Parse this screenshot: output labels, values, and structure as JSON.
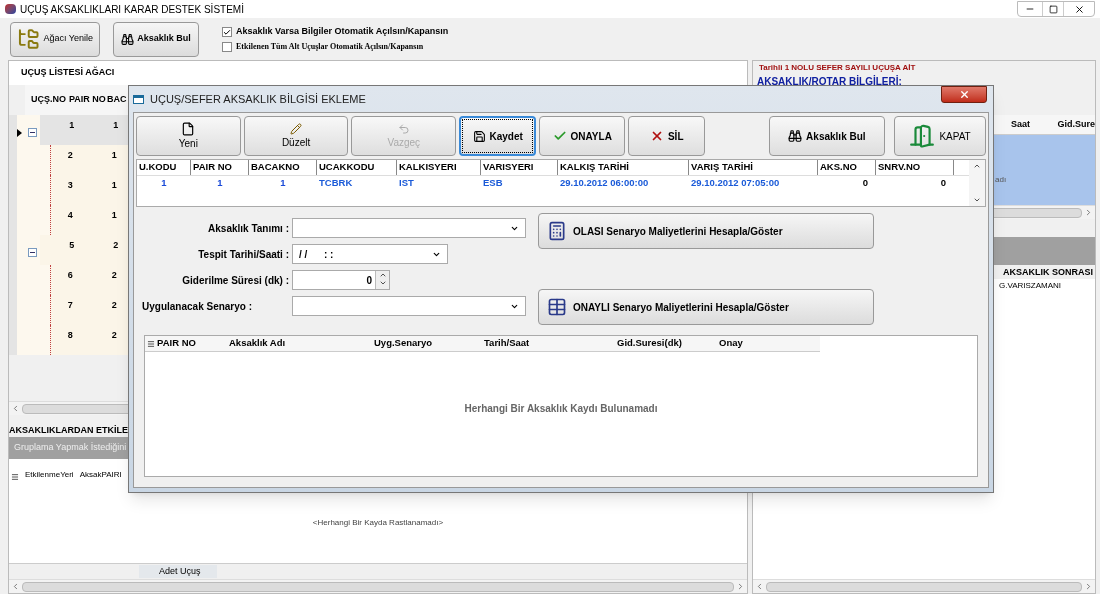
{
  "window": {
    "title": "UÇUŞ AKSAKLIKLARI KARAR DESTEK SİSTEMİ"
  },
  "toolbar": {
    "buttons": [
      {
        "label": "Ağacı Yenile",
        "kind": "tree"
      },
      {
        "label": "Aksaklık Bul",
        "kind": "find"
      }
    ],
    "options": [
      {
        "label": "Aksaklık Varsa Bilgiler Otomatik Açılsın/Kapansın",
        "checked": true
      },
      {
        "label": "Etkilenen Tüm Alt Uçuşlar Otomatik Açılsın/Kapansın",
        "checked": false
      }
    ]
  },
  "tree_panel": {
    "title": "UÇUŞ LİSTESİ AĞACI",
    "columns": [
      "UÇŞ.NO",
      "PAIR NO",
      "BAC"
    ],
    "rows": [
      {
        "uc_no": "1",
        "pair_no": "1",
        "selected": true,
        "expanded": true,
        "children": [
          {
            "uc_no": "2",
            "pair_no": "1",
            "selected": false
          },
          {
            "uc_no": "3",
            "pair_no": "1",
            "selected": false
          },
          {
            "uc_no": "4",
            "pair_no": "1",
            "selected": false
          }
        ]
      },
      {
        "uc_no": "5",
        "pair_no": "2",
        "selected": false,
        "expanded": true,
        "children": [
          {
            "uc_no": "6",
            "pair_no": "2",
            "selected": false
          },
          {
            "uc_no": "7",
            "pair_no": "2",
            "selected": false
          },
          {
            "uc_no": "8",
            "pair_no": "2",
            "selected": false
          }
        ]
      }
    ]
  },
  "affected_panel": {
    "title": "AKSAKLIKLARDAN ETKİLE",
    "group_hint": "Gruplama Yapmak İstediğini",
    "columns": [
      "EtkilenmeYeri",
      "AksakPAIRI"
    ],
    "empty": "<Herhangi Bir Kayda Rastlanamadı>",
    "footer": "Adet Uçuş"
  },
  "right_panel": {
    "title_line1": "Tarihli 1 NOLU SEFER SAYILI UÇUŞA AİT",
    "title_line2": "AKSAKLIK/ROTAR BİLGİLERİ:",
    "columns": [
      "Saat",
      "Gid.Sure"
    ],
    "row_fragment": "adı",
    "section": "AKSAKLIK SONRASI",
    "section_column": "G.VARISZAMANI"
  },
  "dialog": {
    "title": "UÇUŞ/SEFER AKSAKLIK BİLGİSİ EKLEME",
    "buttons": [
      {
        "label": "Yeni",
        "kind": "new",
        "disabled": false,
        "focused": false
      },
      {
        "label": "Düzelt",
        "kind": "edit",
        "disabled": false,
        "focused": false
      },
      {
        "label": "Vazgeç",
        "kind": "cancel",
        "disabled": true,
        "focused": false
      },
      {
        "label": "Kaydet",
        "kind": "save",
        "disabled": false,
        "focused": true
      },
      {
        "label": "ONAYLA",
        "kind": "approve",
        "disabled": false,
        "focused": false
      },
      {
        "label": "SİL",
        "kind": "delete",
        "disabled": false,
        "focused": false
      },
      {
        "label": "Aksaklık Bul",
        "kind": "find",
        "disabled": false,
        "focused": false
      },
      {
        "label": "KAPAT",
        "kind": "close",
        "disabled": false,
        "focused": false
      }
    ],
    "flight_grid": {
      "columns": [
        {
          "label": "U.KODU",
          "value": "1",
          "kind": "id"
        },
        {
          "label": "PAIR NO",
          "value": "1",
          "kind": "id"
        },
        {
          "label": "BACAKNO",
          "value": "1",
          "kind": "id"
        },
        {
          "label": "UCAKKODU",
          "value": "TCBRK",
          "kind": "text"
        },
        {
          "label": "KALKISYERI",
          "value": "IST",
          "kind": "text"
        },
        {
          "label": "VARISYERI",
          "value": "ESB",
          "kind": "text"
        },
        {
          "label": "KALKIŞ TARİHİ",
          "value": "29.10.2012 06:00:00",
          "kind": "text"
        },
        {
          "label": "VARIŞ TARİHİ",
          "value": "29.10.2012 07:05:00",
          "kind": "text"
        },
        {
          "label": "AKS.NO",
          "value": "0",
          "kind": "count"
        },
        {
          "label": "SNRV.NO",
          "value": "0",
          "kind": "count"
        }
      ]
    },
    "fields": [
      {
        "label": "Aksaklık Tanımı :",
        "kind": "combo"
      },
      {
        "label": "Tespit Tarihi/Saati :",
        "kind": "combo",
        "value": "/ /      : :"
      },
      {
        "label": "Giderilme Süresi (dk) :",
        "kind": "spin",
        "value": "0"
      },
      {
        "label": "Uygulanacak Senaryo :",
        "kind": "combo"
      }
    ],
    "actions": [
      "OLASI Senaryo Maliyetlerini Hesapla/Göster",
      "ONAYLI Senaryo Maliyetlerini Hesapla/Göster"
    ],
    "records": {
      "columns": [
        "PAIR NO",
        "Aksaklık Adı",
        "Uyg.Senaryo",
        "Tarih/Saat",
        "Gid.Suresi(dk)",
        "Onay"
      ],
      "empty": "Herhangi Bir Aksaklık Kaydı Bulunamadı"
    }
  }
}
